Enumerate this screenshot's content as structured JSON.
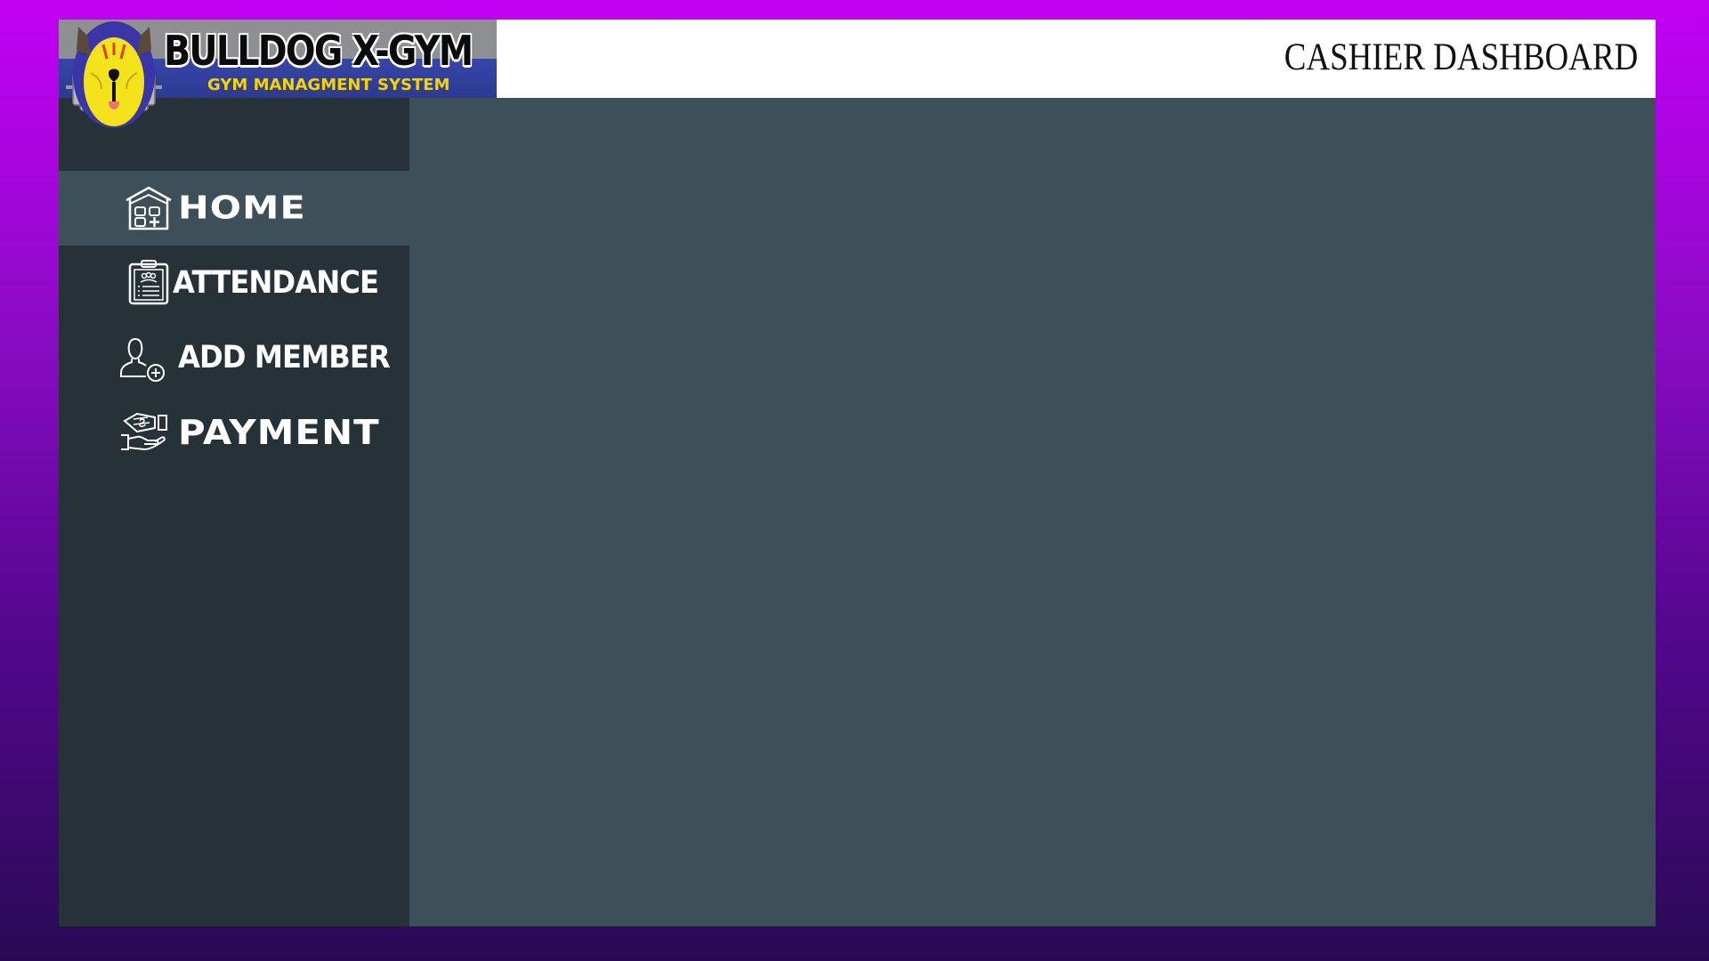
{
  "app": {
    "logo_name": "BULLDOG X-GYM",
    "logo_subtitle": "GYM MANAGMENT SYSTEM",
    "logo_icon": "bulldog-mascot-icon"
  },
  "header": {
    "title": "CASHIER DASHBOARD"
  },
  "sidebar": {
    "active_index": 0,
    "items": [
      {
        "label": "HOME",
        "icon": "home-icon"
      },
      {
        "label": "ATTENDANCE",
        "icon": "clipboard-icon"
      },
      {
        "label": "ADD MEMBER",
        "icon": "add-user-icon"
      },
      {
        "label": "PAYMENT",
        "icon": "payment-hand-icon"
      }
    ]
  },
  "colors": {
    "background_gradient_top": "#c300f5",
    "background_gradient_bottom": "#2a0a55",
    "sidebar": "#263238",
    "content": "#3d505a",
    "active_item": "#3d505a",
    "header": "#ffffff",
    "logo_subtitle": "#f5d400"
  }
}
